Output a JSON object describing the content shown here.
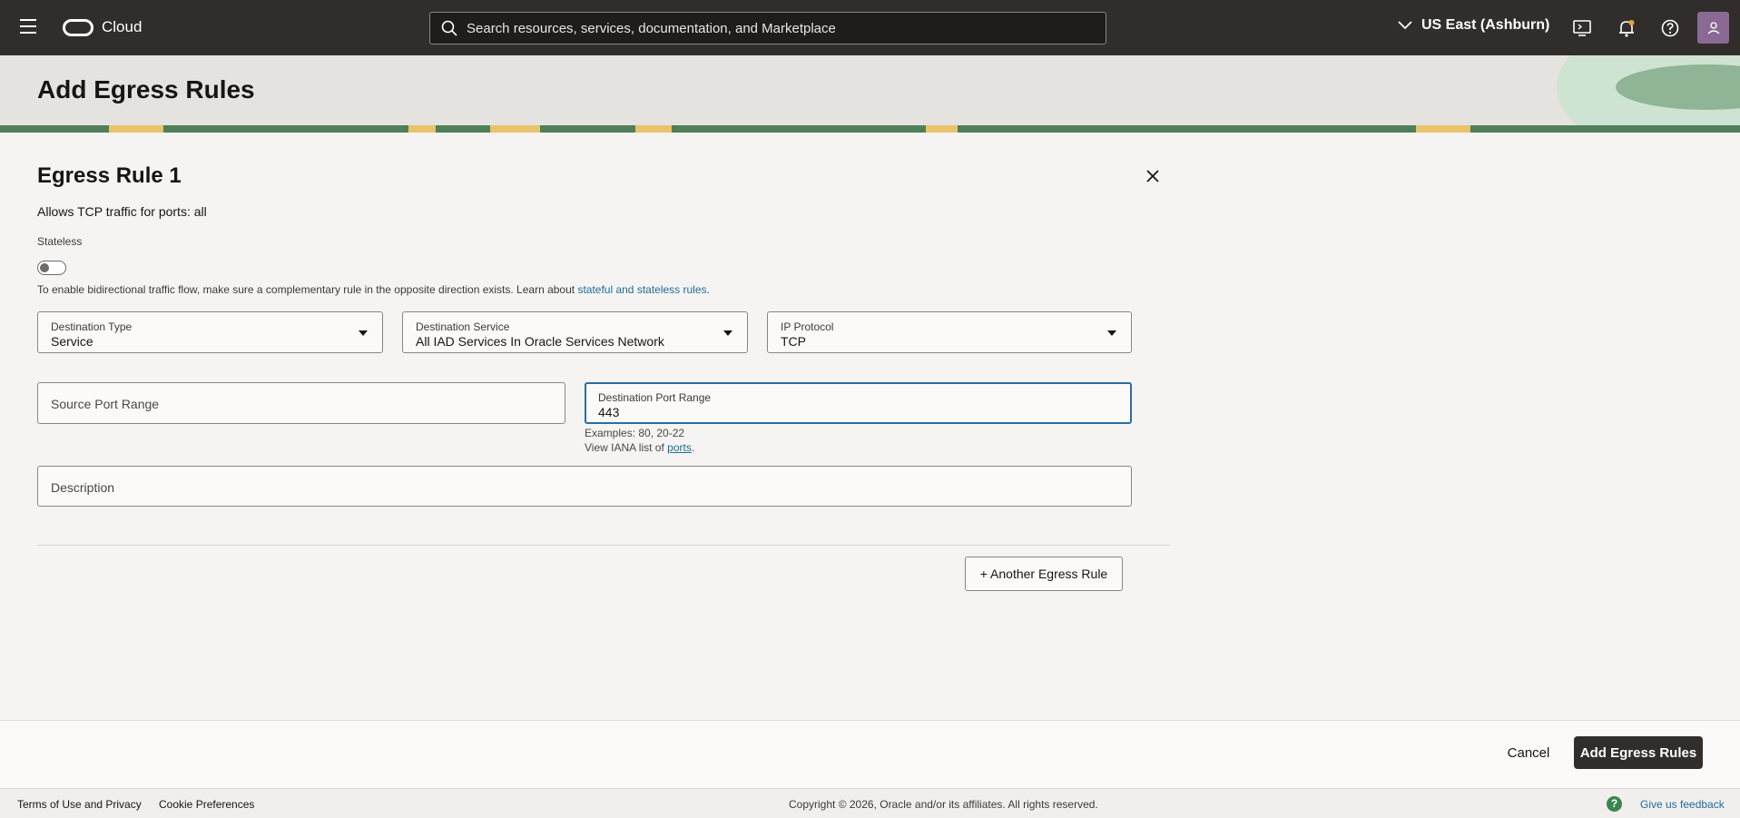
{
  "topbar": {
    "brand": "Cloud",
    "search_placeholder": "Search resources, services, documentation, and Marketplace",
    "region": "US East (Ashburn)"
  },
  "banner": {
    "title": "Add Egress Rules"
  },
  "rule": {
    "title": "Egress Rule 1",
    "summary": "Allows TCP traffic for ports: all",
    "stateless_label": "Stateless",
    "stateless_on": false,
    "hint_text": "To enable bidirectional traffic flow, make sure a complementary rule in the opposite direction exists. Learn about ",
    "hint_link": "stateful and stateless rules",
    "hint_end": ".",
    "destination_type": {
      "label": "Destination Type",
      "value": "Service"
    },
    "destination_service": {
      "label": "Destination Service",
      "value": "All IAD Services In Oracle Services Network"
    },
    "ip_protocol": {
      "label": "IP Protocol",
      "value": "TCP"
    },
    "source_port_range": {
      "placeholder": "Source Port Range"
    },
    "destination_port_range": {
      "label": "Destination Port Range",
      "value": "443"
    },
    "port_examples": "Examples: 80, 20-22",
    "port_view_prefix": "View IANA list of ",
    "port_view_link": "ports",
    "port_view_end": ".",
    "description": {
      "placeholder": "Description"
    },
    "another_button": "+ Another Egress Rule"
  },
  "actions": {
    "cancel": "Cancel",
    "submit": "Add Egress Rules"
  },
  "footer": {
    "terms": "Terms of Use and Privacy",
    "cookies": "Cookie Preferences",
    "copyright": "Copyright © 2026, Oracle and/or its affiliates. All rights reserved.",
    "feedback": "Give us feedback"
  },
  "colors": {
    "topbar": "#312d2a",
    "link": "#1f6c98",
    "focus": "#2b6da1",
    "primary_button": "#312d2a",
    "avatar": "#8a6a94"
  }
}
